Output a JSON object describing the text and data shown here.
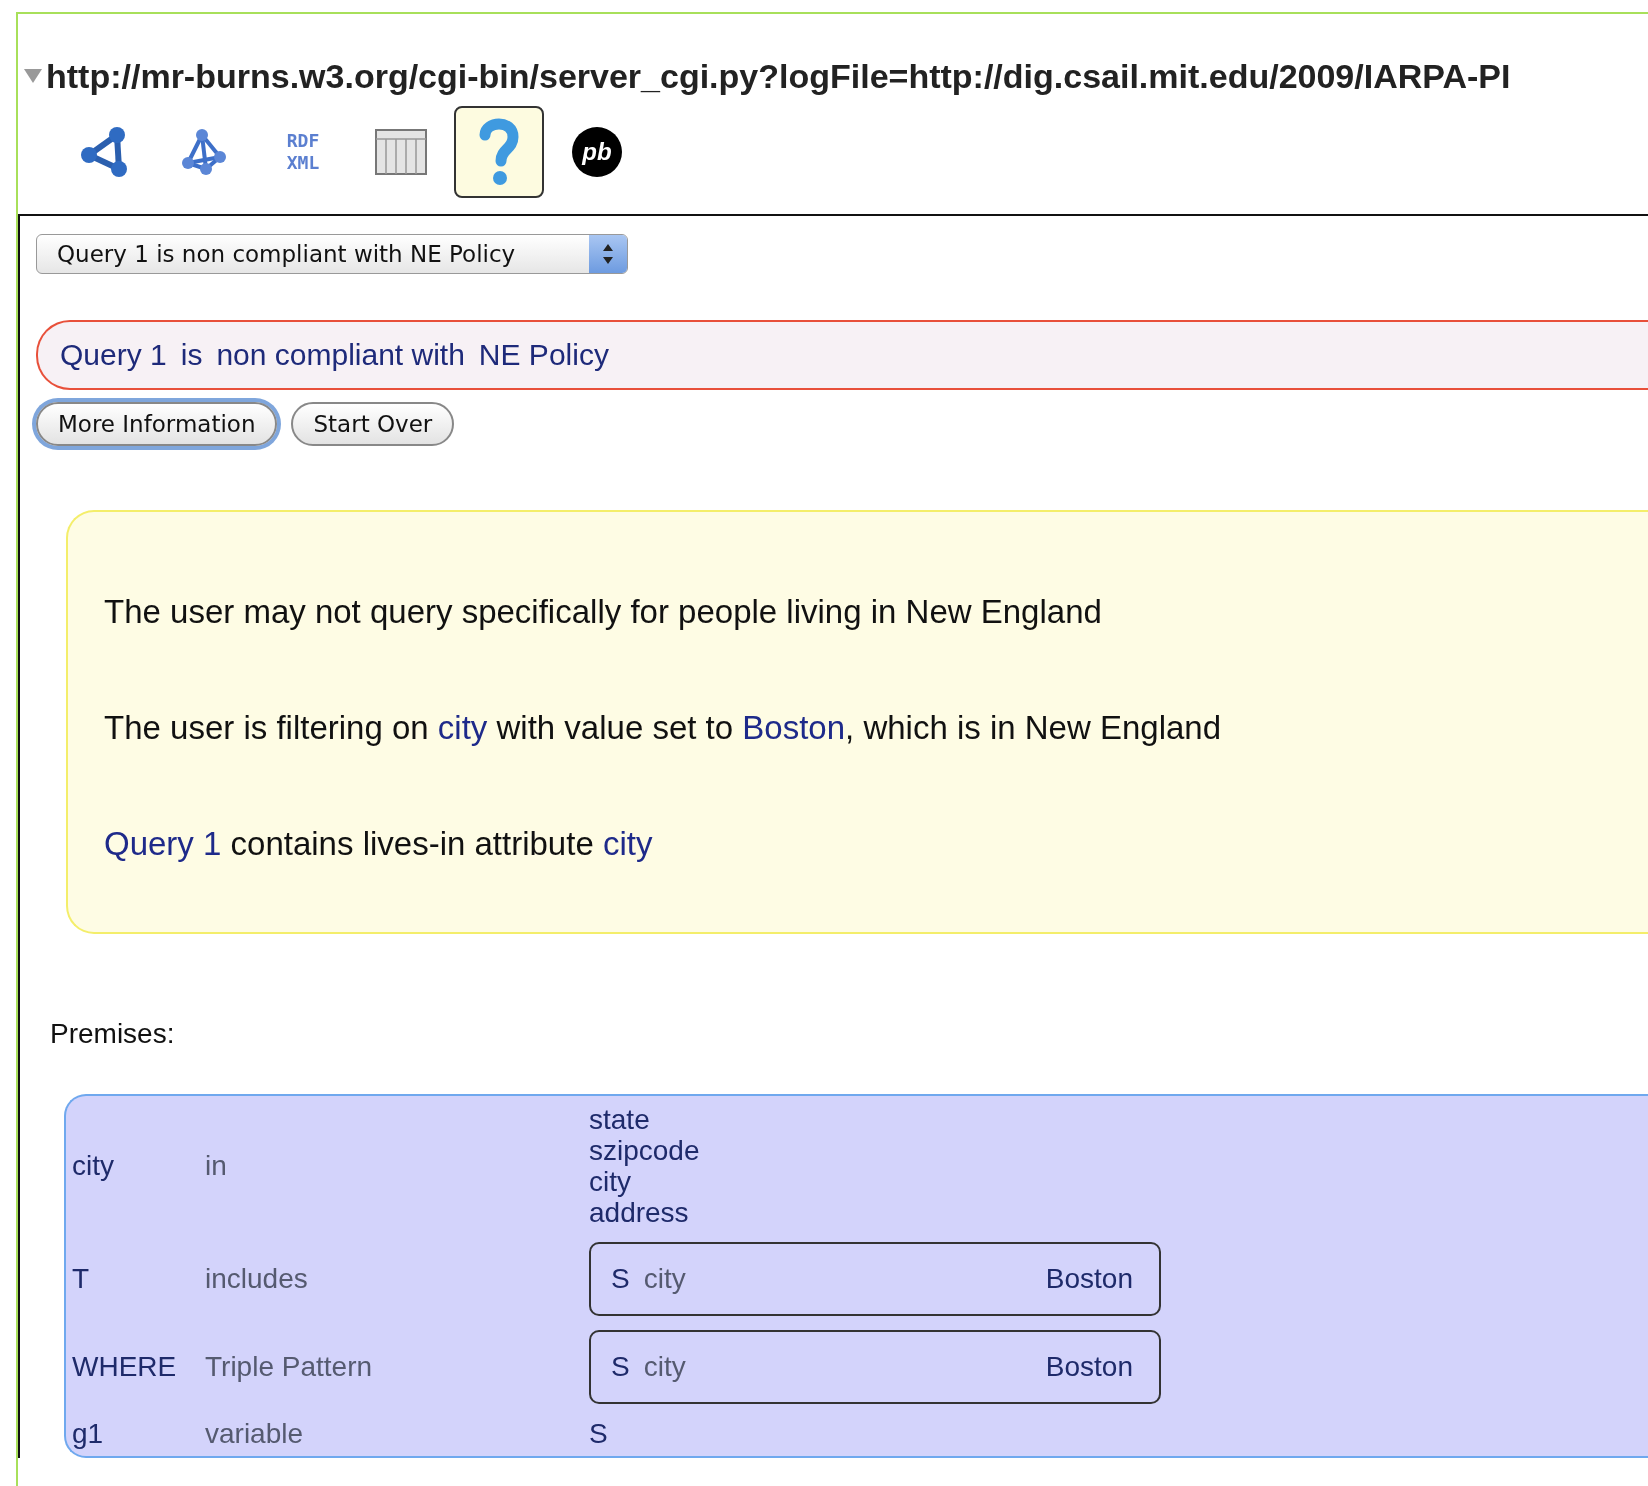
{
  "url_bar": {
    "expanded": true,
    "url": "http://mr-burns.w3.org/cgi-bin/server_cgi.py?logFile=http://dig.csail.mit.edu/2009/IARPA-PI"
  },
  "toolbar": [
    {
      "kind": "graph",
      "selected": false
    },
    {
      "kind": "network",
      "selected": false
    },
    {
      "kind": "rdf",
      "lines": [
        "RDF",
        "XML"
      ],
      "selected": false
    },
    {
      "kind": "table",
      "selected": false
    },
    {
      "kind": "help",
      "selected": true
    },
    {
      "kind": "badge",
      "label": "pb",
      "selected": false
    }
  ],
  "query_select": {
    "value": "Query 1 is non compliant with NE Policy"
  },
  "result": {
    "parts": [
      "Query 1",
      "is",
      "non compliant with",
      "NE Policy"
    ]
  },
  "buttons": [
    {
      "label": "More Information",
      "focused": true
    },
    {
      "label": "Start Over",
      "focused": false
    }
  ],
  "explanation": [
    [
      {
        "text": "The user may not query specifically for people living in New England",
        "link": false
      }
    ],
    [
      {
        "text": "The user is filtering on ",
        "link": false
      },
      {
        "text": "city",
        "link": true
      },
      {
        "text": " with value set to ",
        "link": false
      },
      {
        "text": "Boston",
        "link": true
      },
      {
        "text": ", which is in New England",
        "link": false
      }
    ],
    [
      {
        "text": "Query 1",
        "link": true
      },
      {
        "text": " contains lives-in attribute ",
        "link": false
      },
      {
        "text": "city",
        "link": true
      }
    ]
  ],
  "premises_label": "Premises:",
  "premises": [
    {
      "subject": "city",
      "relation": "in",
      "kind": "list",
      "items": [
        "state",
        "szipcode",
        "city",
        "address"
      ]
    },
    {
      "subject": "T",
      "relation": "includes",
      "kind": "triple",
      "triple": [
        "S",
        "city",
        "Boston"
      ]
    },
    {
      "subject": "WHERE",
      "relation": "Triple Pattern",
      "kind": "triple",
      "triple": [
        "S",
        "city",
        "Boston"
      ]
    },
    {
      "subject": "g1",
      "relation": "variable",
      "kind": "text",
      "value": "S"
    }
  ]
}
